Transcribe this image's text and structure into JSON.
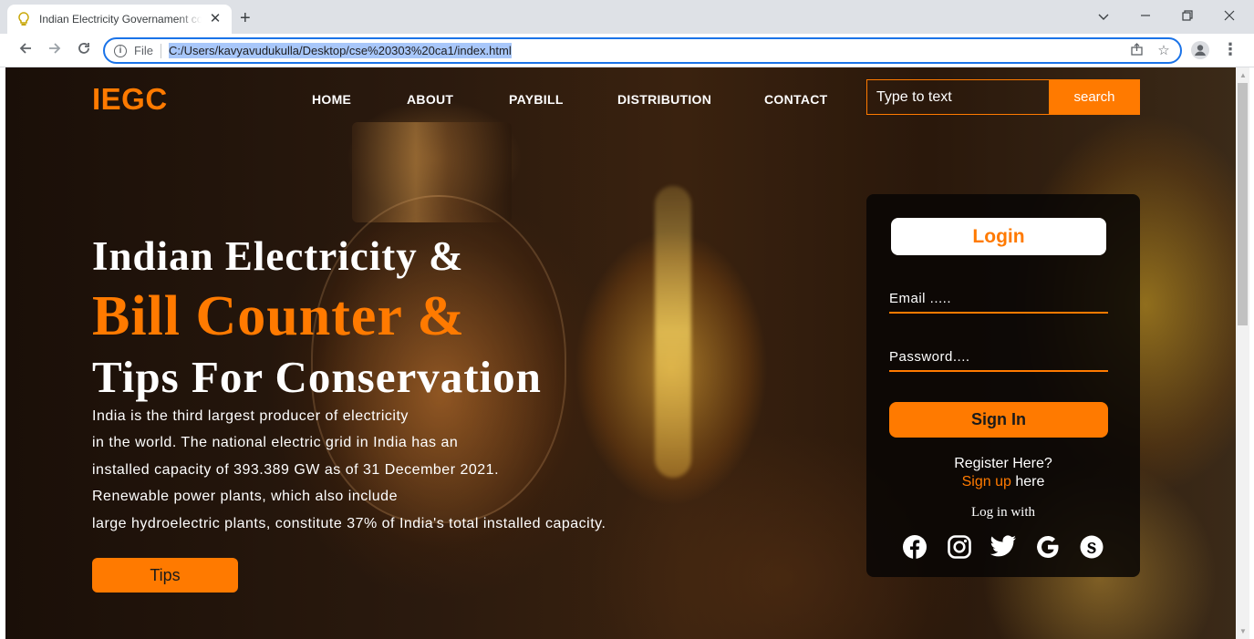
{
  "browser": {
    "tab_title": "Indian Electricity Governament co",
    "tab_close": "✕",
    "new_tab": "+",
    "file_label": "File",
    "url": "C:/Users/kavyavudukulla/Desktop/cse%20303%20ca1/index.html",
    "icons": [
      "back-arrow-icon",
      "forward-arrow-icon",
      "reload-icon",
      "info-icon",
      "share-icon",
      "star-icon",
      "profile-icon",
      "menu-dots-icon",
      "chevron-down-icon",
      "minimize-icon",
      "restore-icon",
      "close-icon"
    ]
  },
  "site": {
    "logo": "IEGC",
    "nav": [
      "HOME",
      "ABOUT",
      "PAYBILL",
      "DISTRIBUTION",
      "CONTACT"
    ],
    "search": {
      "placeholder": "Type to text",
      "button": "search"
    }
  },
  "hero": {
    "line1": "Indian Electricity &",
    "line2": "Bill Counter &",
    "line3": "Tips For Conservation",
    "description": [
      "India is the third largest producer of electricity",
      "in the world. The national electric grid in India has an",
      "installed capacity of 393.389 GW as of 31 December 2021.",
      "Renewable power plants, which also include",
      "large hydroelectric plants, constitute 37% of India's total installed capacity."
    ],
    "tips_button": "Tips"
  },
  "login": {
    "title": "Login",
    "email_placeholder": "Email .....",
    "password_placeholder": "Password....",
    "signin_button": "Sign In",
    "register_text": "Register Here?",
    "signup_link": "Sign up",
    "signup_suffix": " here",
    "login_with": "Log in with",
    "social_icons": [
      "facebook-icon",
      "instagram-icon",
      "twitter-icon",
      "google-icon",
      "skype-icon"
    ]
  },
  "colors": {
    "accent": "#ff7a00",
    "text_light": "#ffffff",
    "card_bg": "#080605",
    "omnibox_focus": "#1a73e8"
  }
}
